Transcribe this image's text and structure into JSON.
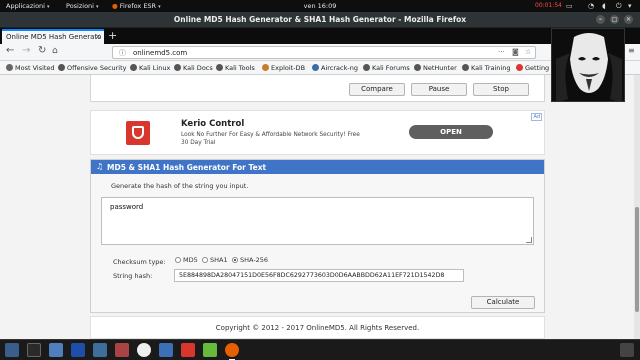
{
  "topbar": {
    "applications": "Applicazioni",
    "places": "Posizioni",
    "app": "Firefox ESR",
    "clock": "ven 16:09",
    "recording": "00:01:54"
  },
  "window": {
    "title": "Online MD5 Hash Generator & SHA1 Hash Generator - Mozilla Firefox"
  },
  "tab": {
    "label": "Online MD5 Hash Generato"
  },
  "address": {
    "url": "onlinemd5.com"
  },
  "bookmarks": [
    "Most Visited",
    "Offensive Security",
    "Kali Linux",
    "Kali Docs",
    "Kali Tools",
    "Exploit-DB",
    "Aircrack-ng",
    "Kali Forums",
    "NetHunter",
    "Kali Training",
    "Getting"
  ],
  "toolbar": {
    "compare": "Compare",
    "pause": "Pause",
    "stop": "Stop"
  },
  "ad": {
    "title": "Kerio Control",
    "desc": "Look No Further For Easy & Affordable Network Security! Free 30 Day Trial",
    "open": "OPEN",
    "tag": "Ad"
  },
  "hash": {
    "header": "MD5 & SHA1 Hash Generator For Text",
    "instruction": "Generate the hash of the string you input.",
    "input": "password",
    "checksum_label": "Checksum type:",
    "types": [
      "MD5",
      "SHA1",
      "SHA-256"
    ],
    "selected": "SHA-256",
    "string_hash_label": "String hash:",
    "result": "5E884898DA28047151D0E56F8DC6292773603D0D6AABBDD62A11EF721D1542D8",
    "calculate": "Calculate"
  },
  "footer": {
    "text": "Copyright © 2012 - 2017 OnlineMD5. All Rights Reserved."
  },
  "colors": {
    "accent": "#3f74c7",
    "tab_highlight": "#0a84ff",
    "ad_logo": "#d9372d"
  }
}
